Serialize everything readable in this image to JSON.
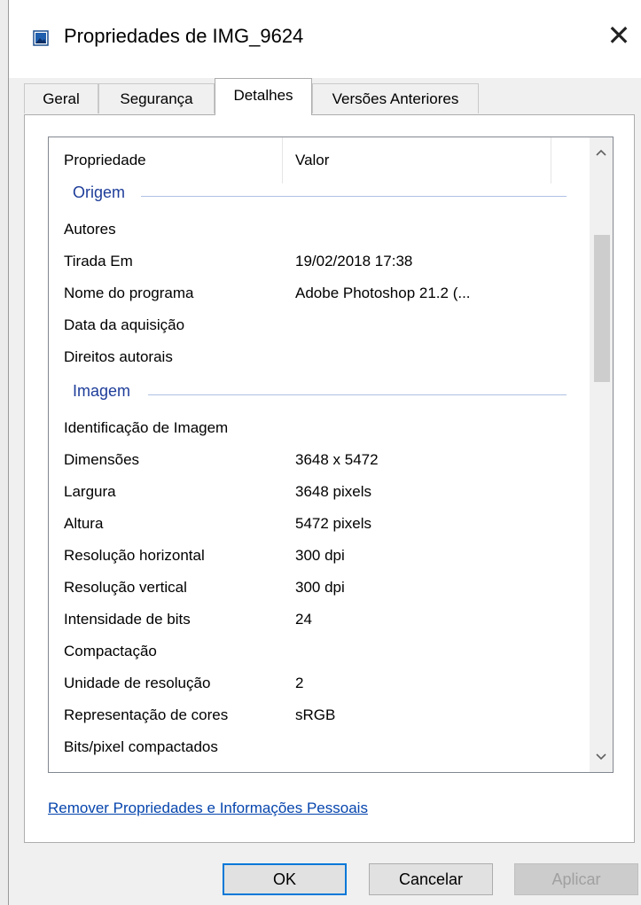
{
  "window": {
    "title": "Propriedades de IMG_9624",
    "close_glyph": "✕"
  },
  "tabs": [
    {
      "label": "Geral",
      "active": false
    },
    {
      "label": "Segurança",
      "active": false
    },
    {
      "label": "Detalhes",
      "active": true
    },
    {
      "label": "Versões Anteriores",
      "active": false
    }
  ],
  "columns": {
    "property": "Propriedade",
    "value": "Valor"
  },
  "groups": {
    "origem": {
      "label": "Origem",
      "rows": [
        {
          "property": "Autores",
          "value": ""
        },
        {
          "property": "Tirada Em",
          "value": "19/02/2018 17:38"
        },
        {
          "property": "Nome do programa",
          "value": "Adobe Photoshop 21.2 (..."
        },
        {
          "property": "Data da aquisição",
          "value": ""
        },
        {
          "property": "Direitos autorais",
          "value": ""
        }
      ]
    },
    "imagem": {
      "label": "Imagem",
      "rows": [
        {
          "property": "Identificação de Imagem",
          "value": ""
        },
        {
          "property": "Dimensões",
          "value": "3648 x 5472"
        },
        {
          "property": "Largura",
          "value": "3648 pixels"
        },
        {
          "property": "Altura",
          "value": "5472 pixels"
        },
        {
          "property": "Resolução horizontal",
          "value": "300 dpi"
        },
        {
          "property": "Resolução vertical",
          "value": "300 dpi"
        },
        {
          "property": "Intensidade de bits",
          "value": "24"
        },
        {
          "property": "Compactação",
          "value": ""
        },
        {
          "property": "Unidade de resolução",
          "value": "2"
        },
        {
          "property": "Representação de cores",
          "value": "sRGB"
        },
        {
          "property": "Bits/pixel compactados",
          "value": ""
        }
      ]
    }
  },
  "link": {
    "remove_properties": "Remover Propriedades e Informações Pessoais"
  },
  "buttons": {
    "ok": "OK",
    "cancel": "Cancelar",
    "apply": "Aplicar"
  },
  "icons": {
    "app": "image-file-icon",
    "scroll_up": "chevron-up-icon",
    "scroll_down": "chevron-down-icon"
  },
  "colors": {
    "accent": "#0078d7",
    "group_text": "#1e3d9a",
    "link": "#0645ad"
  }
}
